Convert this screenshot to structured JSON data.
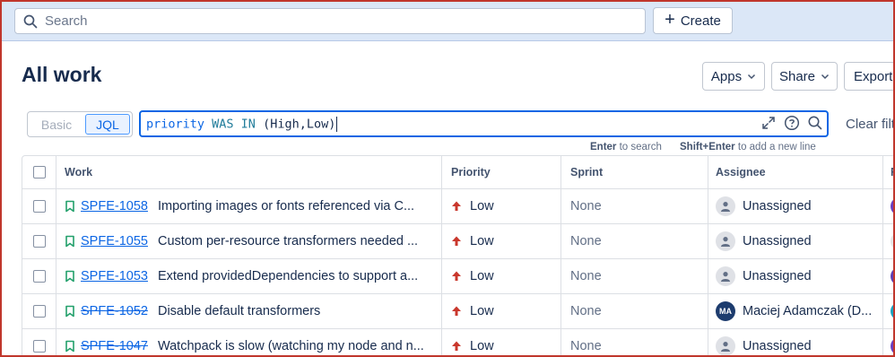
{
  "topbar": {
    "search_placeholder": "Search",
    "create_label": "Create"
  },
  "page": {
    "title": "All work",
    "apps_label": "Apps",
    "share_label": "Share",
    "export_label": "Export"
  },
  "filter": {
    "basic_label": "Basic",
    "jql_label": "JQL",
    "query_field": "priority",
    "query_keywords": "WAS IN",
    "query_rest": "(High,Low)",
    "clear_label": "Clear filters",
    "hint_enter_key": "Enter",
    "hint_enter_text": "to search",
    "hint_shift_key": "Shift+Enter",
    "hint_shift_text": "to add a new line"
  },
  "table": {
    "columns": [
      "Work",
      "Priority",
      "Sprint",
      "Assignee",
      "R"
    ],
    "rows": [
      {
        "key": "SPFE-1058",
        "done": false,
        "summary": "Importing images or fonts referenced via C...",
        "priority": "Low",
        "sprint": "None",
        "assignee": "Unassigned",
        "avatar_type": "unassigned",
        "avatar_initials": "",
        "reporter_color": "#6a3fc1"
      },
      {
        "key": "SPFE-1055",
        "done": false,
        "summary": "Custom per-resource transformers needed ...",
        "priority": "Low",
        "sprint": "None",
        "assignee": "Unassigned",
        "avatar_type": "unassigned",
        "avatar_initials": "",
        "reporter_color": "#e6e6e6"
      },
      {
        "key": "SPFE-1053",
        "done": false,
        "summary": "Extend providedDependencies to support a...",
        "priority": "Low",
        "sprint": "None",
        "assignee": "Unassigned",
        "avatar_type": "unassigned",
        "avatar_initials": "",
        "reporter_color": "#5e3fb5"
      },
      {
        "key": "SPFE-1052",
        "done": true,
        "summary": "Disable default transformers",
        "priority": "Low",
        "sprint": "None",
        "assignee": "Maciej Adamczak (D...",
        "avatar_type": "initials",
        "avatar_initials": "MA",
        "reporter_color": "#1aa3c0"
      },
      {
        "key": "SPFE-1047",
        "done": true,
        "summary": "Watchpack is slow (watching my node and n...",
        "priority": "Low",
        "sprint": "None",
        "assignee": "Unassigned",
        "avatar_type": "unassigned",
        "avatar_initials": "",
        "reporter_color": "#6a3fc1"
      }
    ]
  },
  "colors": {
    "accent": "#0c66e4",
    "priority_low_arrow": "#c9372c",
    "story_icon": "#22a06b",
    "highlight_border": "#c0362c"
  }
}
